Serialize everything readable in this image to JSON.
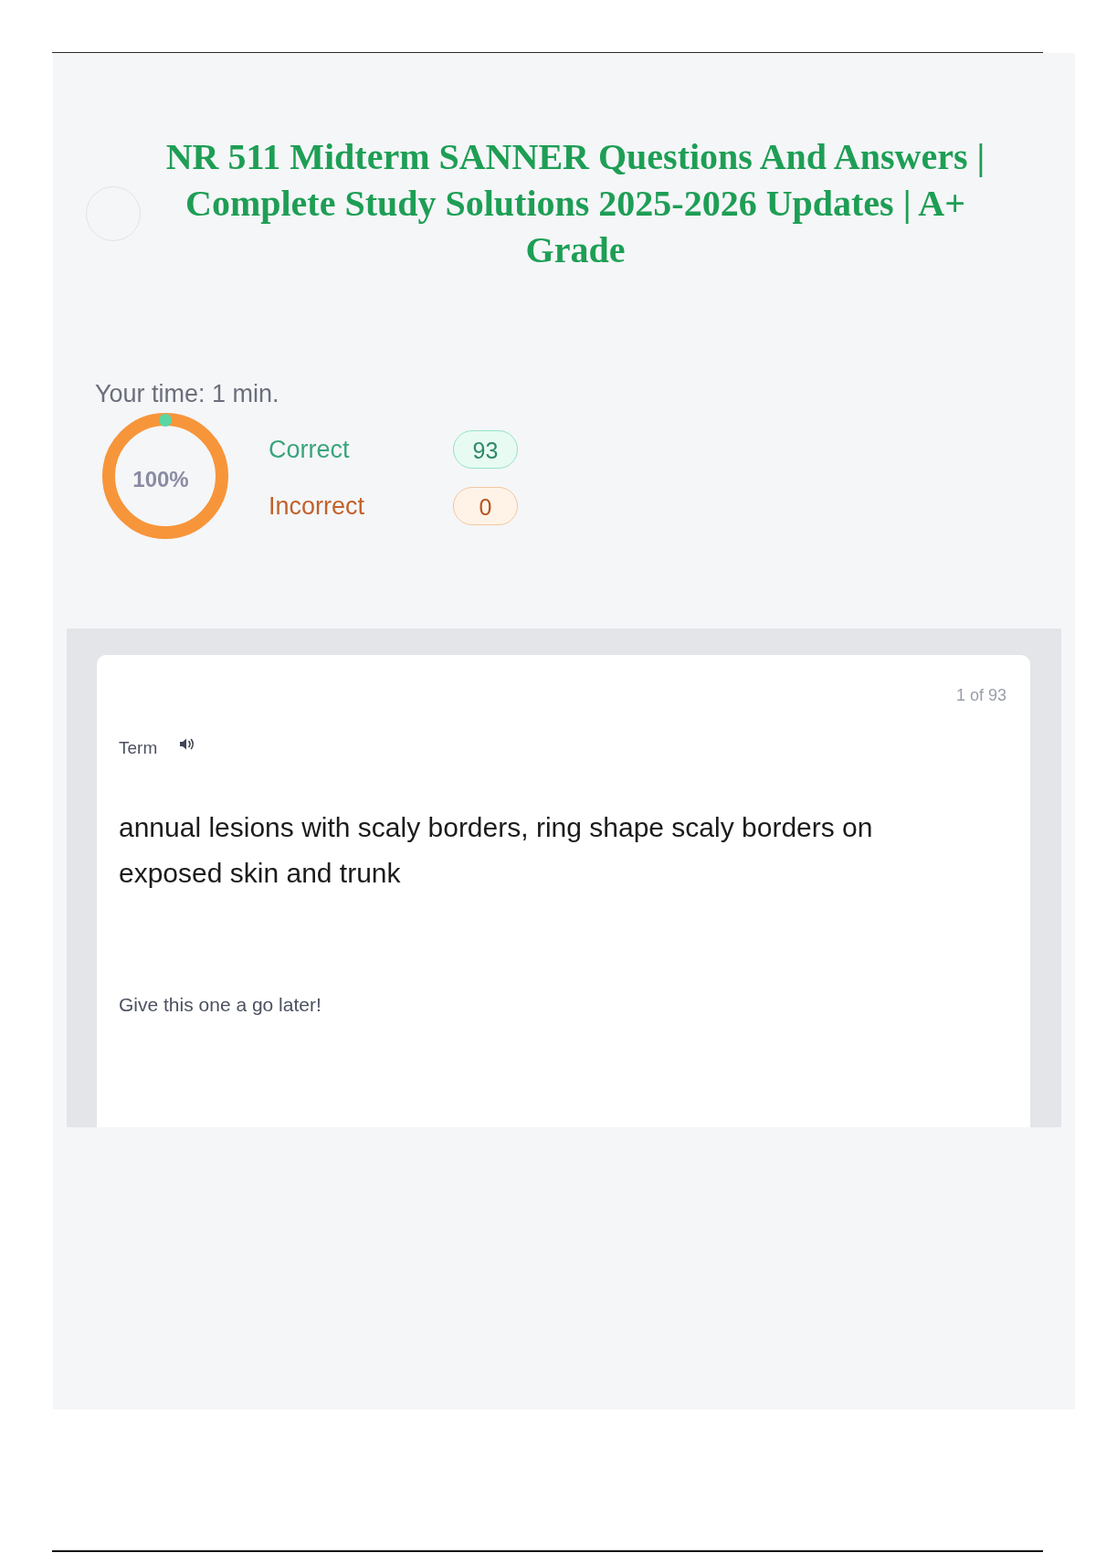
{
  "header": {
    "title": "NR 511 Midterm SANNER Questions And Answers | Complete Study Solutions 2025-2026 Updates | A+ Grade"
  },
  "results": {
    "time": "Your time: 1 min.",
    "score": "100%",
    "stats": [
      {
        "kind": "correct",
        "label": "Correct",
        "count": "93"
      },
      {
        "kind": "incorrect",
        "label": "Incorrect",
        "count": "0"
      }
    ]
  },
  "card": {
    "counter": "1 of 93",
    "side_label": "Term",
    "term": "annual lesions with scaly borders, ring shape scaly borders on exposed skin and trunk",
    "hint": "Give this one a go later!"
  }
}
